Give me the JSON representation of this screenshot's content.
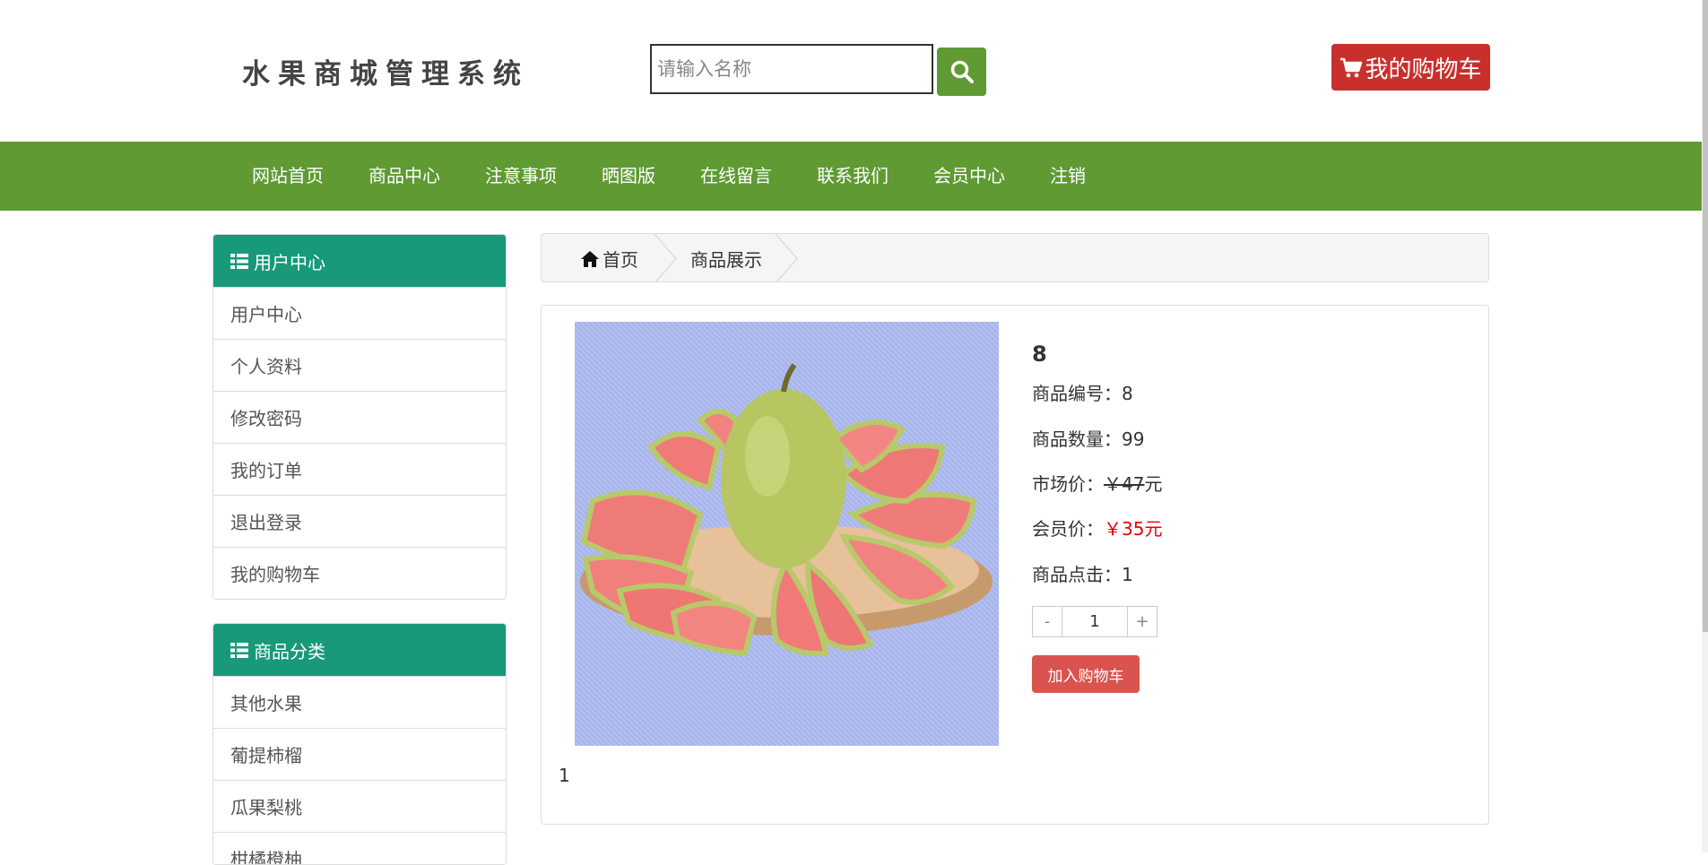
{
  "header": {
    "site_title": "水果商城管理系统",
    "search_placeholder": "请输入名称",
    "search_value": "",
    "cart_label": "我的购物车"
  },
  "nav": {
    "items": [
      "网站首页",
      "商品中心",
      "注意事项",
      "晒图版",
      "在线留言",
      "联系我们",
      "会员中心",
      "注销"
    ]
  },
  "sidebar": {
    "user_center": {
      "title": "用户中心",
      "items": [
        "用户中心",
        "个人资料",
        "修改密码",
        "我的订单",
        "退出登录",
        "我的购物车"
      ]
    },
    "categories": {
      "title": "商品分类",
      "items": [
        "其他水果",
        "葡提柿榴",
        "瓜果梨桃",
        "柑橘橙柚"
      ]
    }
  },
  "breadcrumb": {
    "home": "首页",
    "current": "商品展示"
  },
  "product": {
    "name": "8",
    "id_label": "商品编号：",
    "id_value": "8",
    "qty_label": "商品数量：",
    "qty_value": "99",
    "market_label": "市场价：",
    "market_price": "￥47",
    "market_unit": "元",
    "member_label": "会员价：",
    "member_price": "￥35元",
    "clicks_label": "商品点击：",
    "clicks_value": "1",
    "quantity": "1",
    "minus": "-",
    "plus": "+",
    "add_to_cart": "加入购物车",
    "detail": "1"
  },
  "colors": {
    "nav_green": "#5f9a33",
    "panel_teal": "#17997a",
    "cart_red": "#c9302c",
    "add_cart_red": "#d9534f",
    "price_red": "#e60000"
  }
}
